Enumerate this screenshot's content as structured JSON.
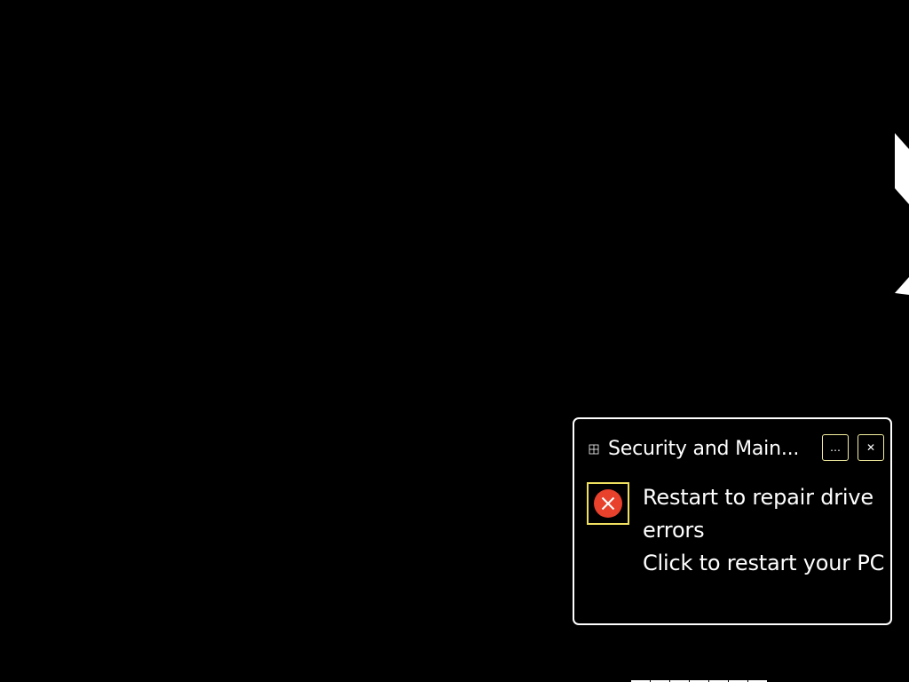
{
  "notification": {
    "app_name": "Security and Main...",
    "app_icon": "security-maintenance-icon",
    "more_icon": "…",
    "close_icon": "✕",
    "status_icon": "error-icon",
    "title": "Restart to repair drive errors",
    "message": "Click to restart your PC"
  },
  "colors": {
    "background": "#000000",
    "text": "#ffffff",
    "border": "#ffffff",
    "focus_outline": "#f0e060",
    "error_red": "#e8412c"
  }
}
